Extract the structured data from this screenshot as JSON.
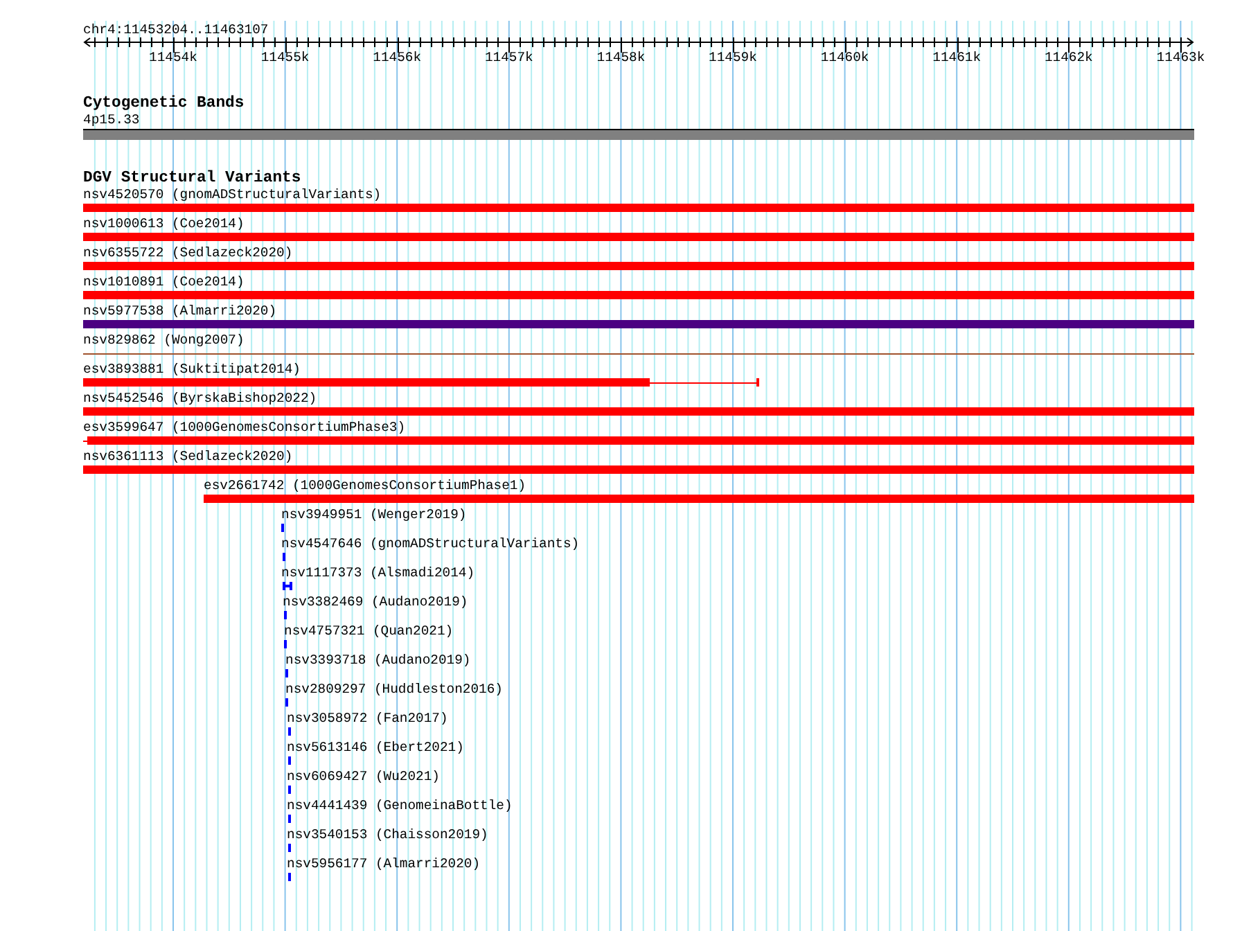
{
  "ruler": {
    "location": "chr4:11453204..11463107",
    "ticks": [
      "11454k",
      "11455k",
      "11456k",
      "11457k",
      "11458k",
      "11459k",
      "11460k",
      "11461k",
      "11462k",
      "11463k"
    ]
  },
  "tracks": [
    {
      "title": "Cytogenetic Bands",
      "features": [
        {
          "label": "4p15.33",
          "kind": "band",
          "color": "#808080"
        }
      ]
    },
    {
      "title": "DGV Structural Variants",
      "features": [
        {
          "label": "nsv4520570 (gnomADStructuralVariants)",
          "kind": "bar",
          "color": "#ff0000"
        },
        {
          "label": "nsv1000613 (Coe2014)",
          "kind": "bar",
          "color": "#ff0000"
        },
        {
          "label": "nsv6355722 (Sedlazeck2020)",
          "kind": "bar",
          "color": "#ff0000"
        },
        {
          "label": "nsv1010891 (Coe2014)",
          "kind": "bar",
          "color": "#ff0000"
        },
        {
          "label": "nsv5977538 (Almarri2020)",
          "kind": "bar",
          "color": "#4b0082"
        },
        {
          "label": "nsv829862 (Wong2007)",
          "kind": "line",
          "color": "#a0522d"
        },
        {
          "label": "esv3893881 (Suktitipat2014)",
          "kind": "split",
          "color": "#ff0000"
        },
        {
          "label": "nsv5452546 (ByrskaBishop2022)",
          "kind": "bar",
          "color": "#ff0000"
        },
        {
          "label": "esv3599647 (1000GenomesConsortiumPhase3)",
          "kind": "lead",
          "color": "#ff0000"
        },
        {
          "label": "nsv6361113 (Sedlazeck2020)",
          "kind": "bar",
          "color": "#ff0000"
        },
        {
          "label": "esv2661742 (1000GenomesConsortiumPhase1)",
          "kind": "bar",
          "color": "#ff0000"
        },
        {
          "label": "nsv3949951 (Wenger2019)",
          "kind": "bar",
          "color": "#0000ff"
        },
        {
          "label": "nsv4547646 (gnomADStructuralVariants)",
          "kind": "bar",
          "color": "#0000ff"
        },
        {
          "label": "nsv1117373 (Alsmadi2014)",
          "kind": "bracket",
          "color": "#0000ff"
        },
        {
          "label": "nsv3382469 (Audano2019)",
          "kind": "bar",
          "color": "#0000ff"
        },
        {
          "label": "nsv4757321 (Quan2021)",
          "kind": "bar",
          "color": "#0000ff"
        },
        {
          "label": "nsv3393718 (Audano2019)",
          "kind": "bar",
          "color": "#0000ff"
        },
        {
          "label": "nsv2809297 (Huddleston2016)",
          "kind": "bar",
          "color": "#0000ff"
        },
        {
          "label": "nsv3058972 (Fan2017)",
          "kind": "bar",
          "color": "#0000ff"
        },
        {
          "label": "nsv5613146 (Ebert2021)",
          "kind": "bar",
          "color": "#0000ff"
        },
        {
          "label": "nsv6069427 (Wu2021)",
          "kind": "bar",
          "color": "#0000ff"
        },
        {
          "label": "nsv4441439 (GenomeinaBottle)",
          "kind": "bar",
          "color": "#0000ff"
        },
        {
          "label": "nsv3540153 (Chaisson2019)",
          "kind": "bar",
          "color": "#0000ff"
        },
        {
          "label": "nsv5956177 (Almarri2020)",
          "kind": "bar",
          "color": "#0000ff"
        }
      ]
    }
  ]
}
